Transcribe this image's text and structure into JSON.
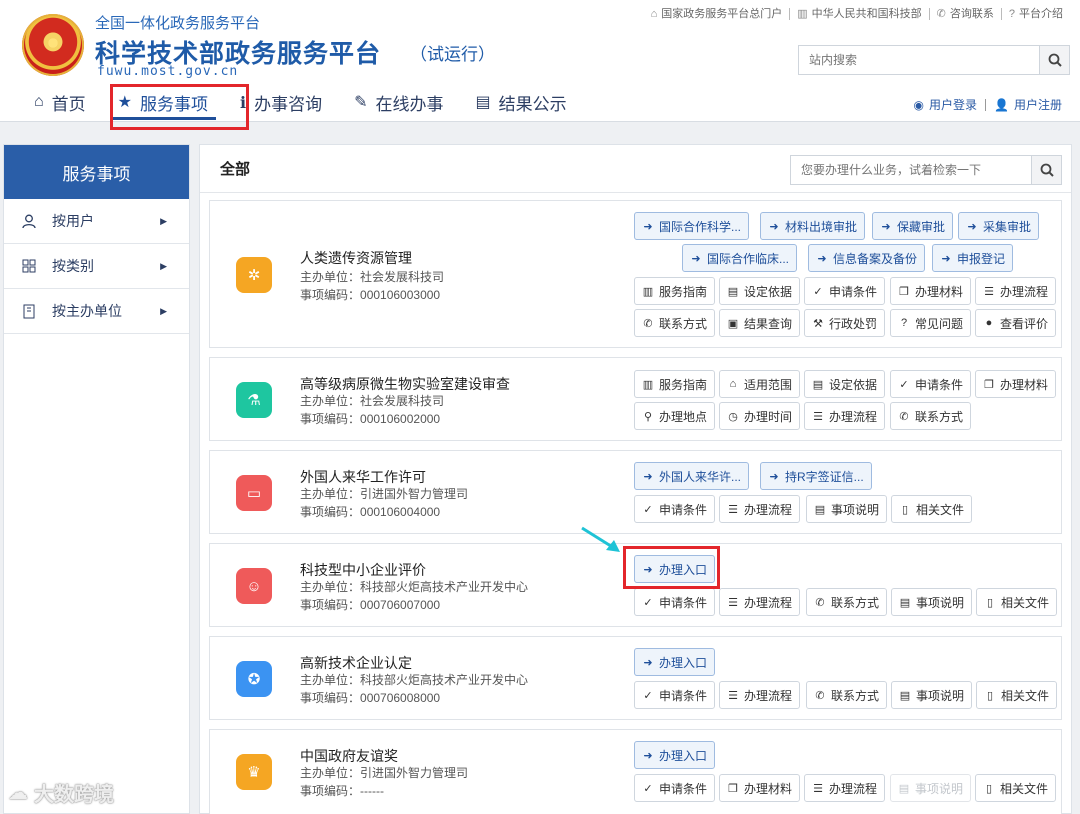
{
  "header": {
    "subtitle": "全国一体化政务服务平台",
    "title": "科学技术部政务服务平台",
    "tag": "（试运行）",
    "url": "fuwu.most.gov.cn"
  },
  "top_links": [
    {
      "label": "国家政务服务平台总门户",
      "icon": "home-icon"
    },
    {
      "label": "中华人民共和国科技部",
      "icon": "building-icon"
    },
    {
      "label": "咨询联系",
      "icon": "phone-icon"
    },
    {
      "label": "平台介绍",
      "icon": "question-icon"
    }
  ],
  "site_search": {
    "placeholder": "站内搜索"
  },
  "nav": [
    {
      "label": "首页",
      "icon": "home-icon"
    },
    {
      "label": "服务事项",
      "icon": "star-icon",
      "active": true
    },
    {
      "label": "办事咨询",
      "icon": "info-icon"
    },
    {
      "label": "在线办事",
      "icon": "pencil-icon"
    },
    {
      "label": "结果公示",
      "icon": "book-icon"
    }
  ],
  "user": {
    "login": "用户登录",
    "register": "用户注册"
  },
  "sidebar": {
    "title": "服务事项",
    "items": [
      {
        "label": "按用户",
        "icon": "user-icon"
      },
      {
        "label": "按类别",
        "icon": "grid-icon"
      },
      {
        "label": "按主办单位",
        "icon": "building-icon"
      }
    ]
  },
  "main": {
    "heading": "全部",
    "search_placeholder": "您要办理什么业务，试着检索一下"
  },
  "labels": {
    "dept_prefix": "主办单位：",
    "code_prefix": "事项编码："
  },
  "services": [
    {
      "name": "人类遗传资源管理",
      "dept": "社会发展科技司",
      "code": "000106003000",
      "icon_color": "#f5a623",
      "icon": "dna-icon",
      "blue_row1": [
        "国际合作科学...",
        "材料出境审批",
        "保藏审批",
        "采集审批"
      ],
      "blue_row2": [
        "国际合作临床...",
        "信息备案及备份",
        "申报登记"
      ],
      "row1": [
        "服务指南",
        "设定依据",
        "申请条件",
        "办理材料",
        "办理流程"
      ],
      "row2": [
        "联系方式",
        "结果查询",
        "行政处罚",
        "常见问题",
        "查看评价"
      ]
    },
    {
      "name": "高等级病原微生物实验室建设审查",
      "dept": "社会发展科技司",
      "code": "000106002000",
      "icon_color": "#1ec6a0",
      "icon": "flask-icon",
      "row1": [
        "服务指南",
        "适用范围",
        "设定依据",
        "申请条件",
        "办理材料"
      ],
      "row2": [
        "办理地点",
        "办理时间",
        "办理流程",
        "联系方式"
      ]
    },
    {
      "name": "外国人来华工作许可",
      "dept": "引进国外智力管理司",
      "code": "000106004000",
      "icon_color": "#ef5a5a",
      "icon": "monitor-icon",
      "blue_row1": [
        "外国人来华许...",
        "持R字签证信..."
      ],
      "row1": [
        "申请条件",
        "办理流程",
        "事项说明",
        "相关文件"
      ]
    },
    {
      "name": "科技型中小企业评价",
      "dept": "科技部火炬高技术产业开发中心",
      "code": "000706007000",
      "icon_color": "#ef5a5a",
      "icon": "person-icon",
      "blue_row1": [
        "办理入口"
      ],
      "row1": [
        "申请条件",
        "办理流程",
        "联系方式",
        "事项说明",
        "相关文件"
      ]
    },
    {
      "name": "高新技术企业认定",
      "dept": "科技部火炬高技术产业开发中心",
      "code": "000706008000",
      "icon_color": "#3b93f2",
      "icon": "award-icon",
      "blue_row1": [
        "办理入口"
      ],
      "row1": [
        "申请条件",
        "办理流程",
        "联系方式",
        "事项说明",
        "相关文件"
      ]
    },
    {
      "name": "中国政府友谊奖",
      "dept": "引进国外智力管理司",
      "code": "------",
      "icon_color": "#f5a623",
      "icon": "trophy-icon",
      "blue_row1": [
        "办理入口"
      ],
      "row1": [
        "申请条件",
        "办理材料",
        "办理流程",
        "事项说明",
        "相关文件"
      ],
      "row1_disabled": [
        false,
        false,
        false,
        true,
        false
      ]
    }
  ],
  "watermark": "大数跨境"
}
